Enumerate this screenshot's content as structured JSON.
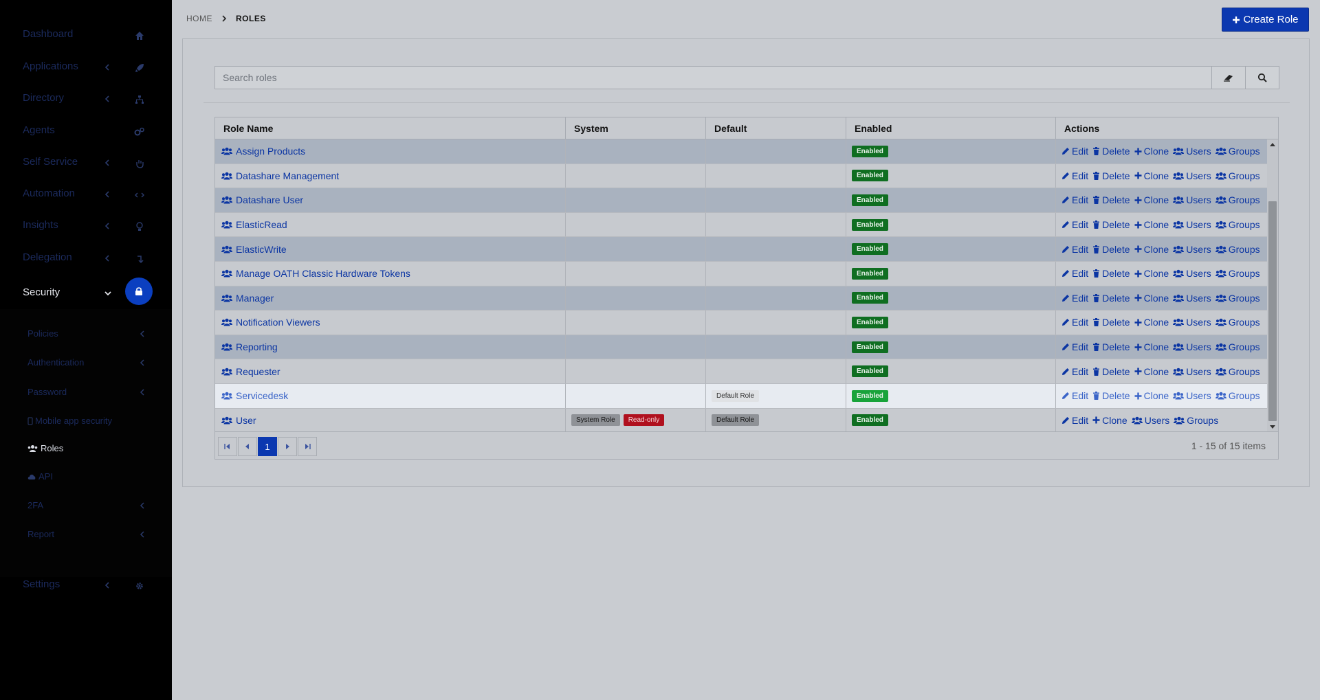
{
  "sidebar": {
    "items": [
      {
        "label": "Dashboard",
        "icon": "home-icon"
      },
      {
        "label": "Applications",
        "icon": "rocket-icon"
      },
      {
        "label": "Directory",
        "icon": "sitemap-icon"
      },
      {
        "label": "Agents",
        "icon": "cogs-icon"
      },
      {
        "label": "Self Service",
        "icon": "hand-icon"
      },
      {
        "label": "Automation",
        "icon": "code-icon"
      },
      {
        "label": "Insights",
        "icon": "lightbulb-icon"
      },
      {
        "label": "Delegation",
        "icon": "delegation-icon"
      },
      {
        "label": "Security",
        "icon": "lock-icon"
      },
      {
        "label": "Settings",
        "icon": "gear-icon"
      }
    ],
    "security_sub": [
      {
        "label": "Policies"
      },
      {
        "label": "Authentication"
      },
      {
        "label": "Password"
      },
      {
        "label": "Mobile app security"
      },
      {
        "label": "Roles"
      },
      {
        "label": "API"
      },
      {
        "label": "2FA"
      },
      {
        "label": "Report"
      }
    ]
  },
  "header": {
    "breadcrumb_home": "HOME",
    "breadcrumb_current": "ROLES",
    "create_label": "Create Role"
  },
  "search": {
    "placeholder": "Search roles"
  },
  "grid": {
    "columns": [
      "Role Name",
      "System",
      "Default",
      "Enabled",
      "Actions"
    ],
    "rows": [
      {
        "name": "Assign Products",
        "enabled": "Enabled"
      },
      {
        "name": "Datashare Management",
        "enabled": "Enabled"
      },
      {
        "name": "Datashare User",
        "enabled": "Enabled"
      },
      {
        "name": "ElasticRead",
        "enabled": "Enabled"
      },
      {
        "name": "ElasticWrite",
        "enabled": "Enabled"
      },
      {
        "name": "Manage OATH Classic Hardware Tokens",
        "enabled": "Enabled"
      },
      {
        "name": "Manager",
        "enabled": "Enabled"
      },
      {
        "name": "Notification Viewers",
        "enabled": "Enabled"
      },
      {
        "name": "Reporting",
        "enabled": "Enabled"
      },
      {
        "name": "Requester",
        "enabled": "Enabled"
      },
      {
        "name": "Servicedesk",
        "default": "Default Role",
        "enabled": "Enabled",
        "highlight": true
      },
      {
        "name": "User",
        "system": "System Role",
        "readonly": "Read-only",
        "default": "Default Role",
        "enabled": "Enabled",
        "no_delete": true
      }
    ],
    "actions": {
      "edit": "Edit",
      "delete": "Delete",
      "clone": "Clone",
      "users": "Users",
      "groups": "Groups"
    }
  },
  "pager": {
    "current_page": "1",
    "info": "1 - 15 of 15 items"
  },
  "colors": {
    "accent": "#0b38b0",
    "enabled_badge": "#0f6e21",
    "readonly_badge": "#b0101e",
    "link": "#0b35a3"
  }
}
